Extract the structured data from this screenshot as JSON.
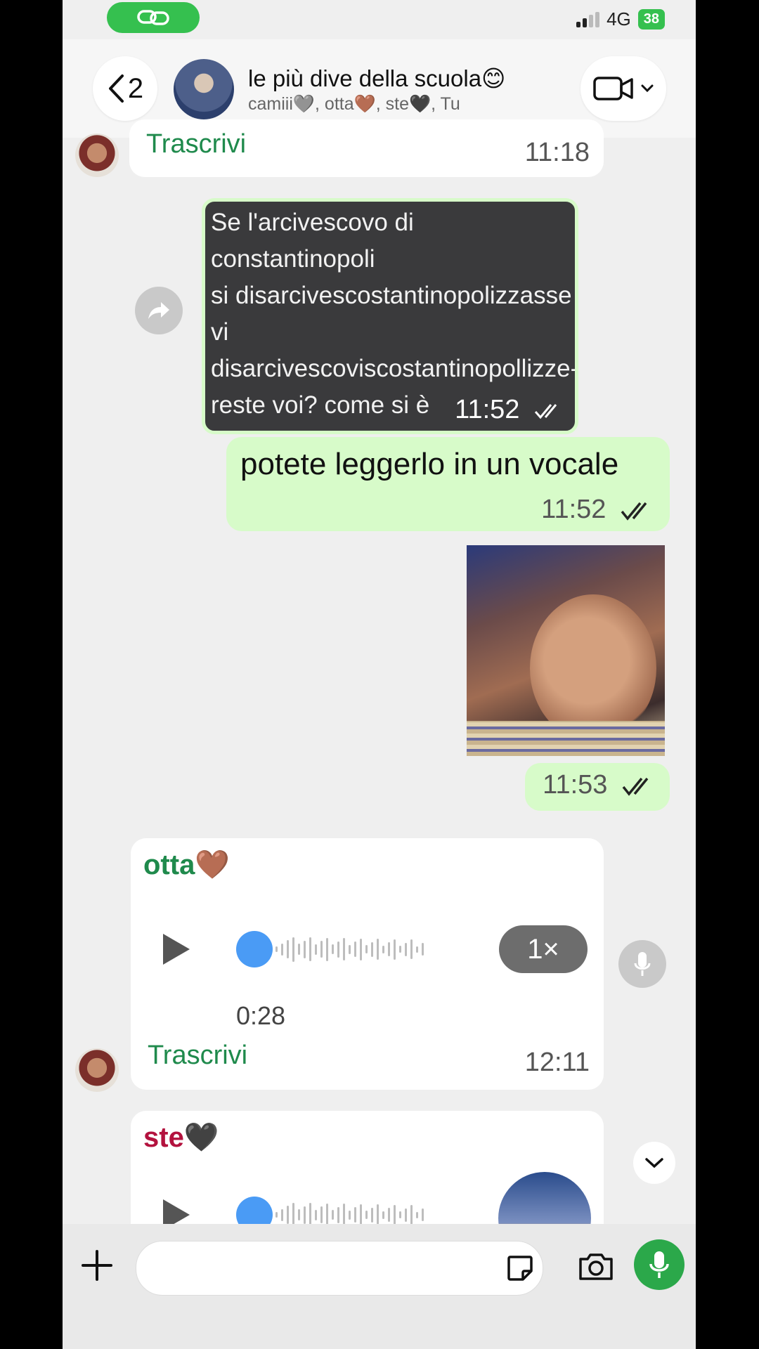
{
  "status_bar": {
    "network": "4G",
    "battery": "38"
  },
  "header": {
    "back_count": "2",
    "title": "le più dive della scuola😊",
    "members": "camiii🩶, otta🤎, ste🖤, Tu"
  },
  "messages": {
    "partial_voice": {
      "transcribe": "Trascrivi",
      "time": "11:18"
    },
    "image_text": {
      "text": "Se l'arcivescovo di constantinopoli\nsi disarcivescostantinopolizzasse vi\ndisarcivescoviscostantinopollizze-\nreste voi? come si è\ndisarcivescovisconstantinopolizza-\nto l'arcivescovo di constantinopoli",
      "time": "11:52"
    },
    "text_message": {
      "text": "potete leggerlo in un vocale",
      "time": "11:52"
    },
    "photo": {
      "time": "11:53"
    },
    "voice_otta": {
      "sender": "otta🤎",
      "speed": "1×",
      "duration": "0:28",
      "transcribe": "Trascrivi",
      "time": "12:11"
    },
    "voice_ste": {
      "sender": "ste🖤"
    }
  },
  "colors": {
    "sender_otta": "#1f8a4c",
    "sender_ste": "#b3123e",
    "accent_green": "#35c04f"
  },
  "icons": [
    "link-icon",
    "chevron-left-icon",
    "video-camera-icon",
    "chevron-down-icon",
    "forward-icon",
    "play-icon",
    "microphone-icon",
    "plus-icon",
    "sticker-icon",
    "camera-icon"
  ]
}
